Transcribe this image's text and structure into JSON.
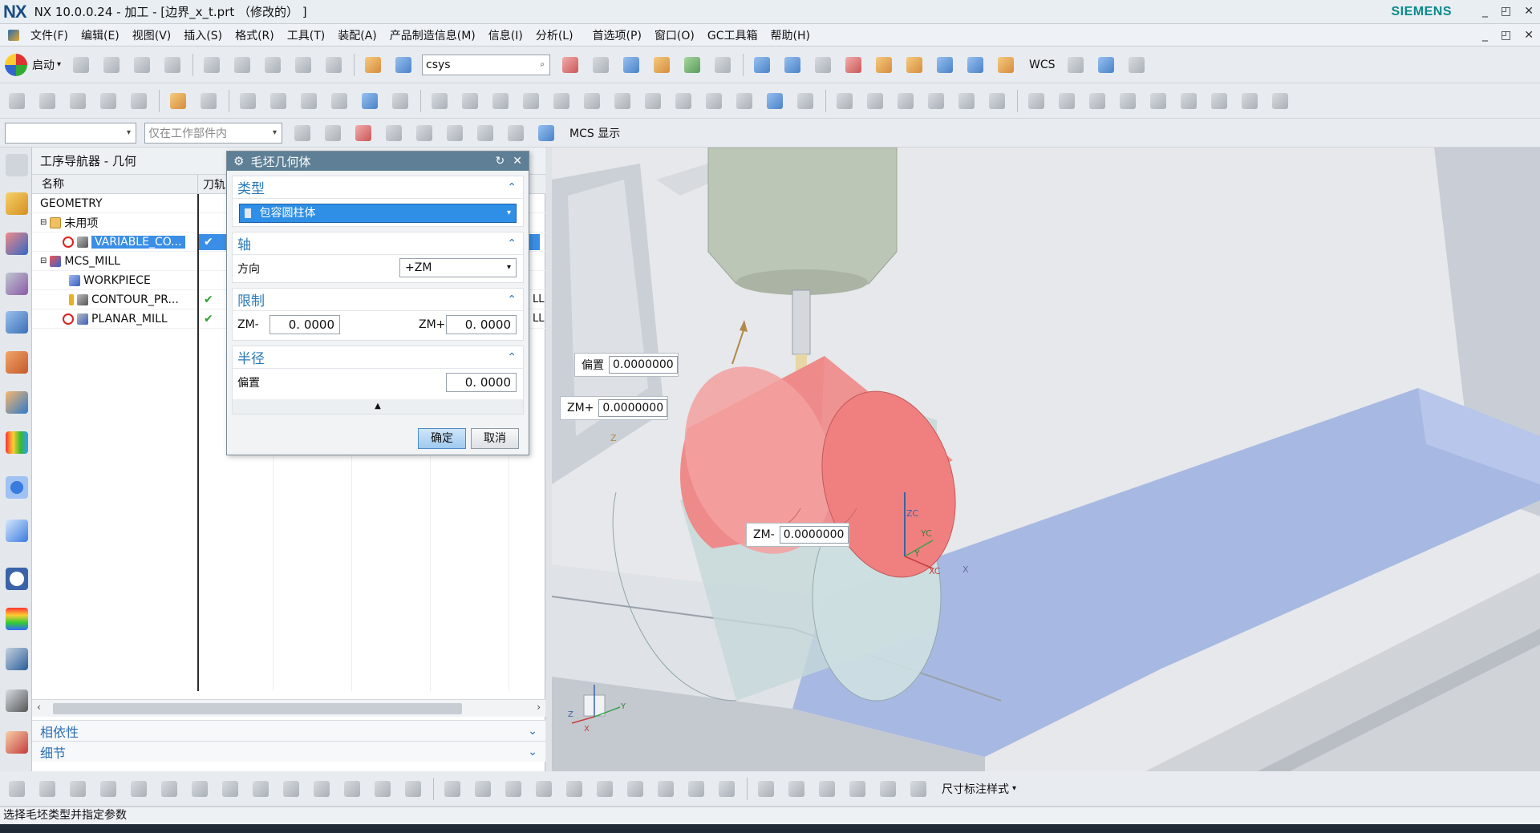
{
  "titlebar": {
    "logo": "NX",
    "title": "NX 10.0.0.24 - 加工 - [边界_x_t.prt （修改的） ]",
    "brand": "SIEMENS",
    "minimize": "_",
    "restore": "◰",
    "close": "✕"
  },
  "menubar": {
    "items": [
      "文件(F)",
      "编辑(E)",
      "视图(V)",
      "插入(S)",
      "格式(R)",
      "工具(T)",
      "装配(A)",
      "产品制造信息(M)",
      "信息(I)",
      "分析(L)",
      "首选项(P)",
      "窗口(O)",
      "GC工具箱",
      "帮助(H)"
    ]
  },
  "toolbar1": {
    "start_label": "启动",
    "csys_value": "csys",
    "wcs_label": "WCS"
  },
  "toolbar3": {
    "filter_placeholder": "",
    "scope_value": "仅在工作部件内",
    "mcs_label": "MCS 显示"
  },
  "navigator": {
    "title": "工序导航器 - 几何",
    "col_name": "名称",
    "col_tool": "刀轨",
    "rows": [
      {
        "label": "GEOMETRY",
        "indent": 0
      },
      {
        "label": "未用项",
        "indent": 1
      },
      {
        "label": "VARIABLE_CO...",
        "indent": 2,
        "check": "✔",
        "selected": true
      },
      {
        "label": "MCS_MILL",
        "indent": 1
      },
      {
        "label": "WORKPIECE",
        "indent": 2
      },
      {
        "label": "CONTOUR_PR...",
        "indent": 2,
        "check": "✔",
        "extra": "LL"
      },
      {
        "label": "PLANAR_MILL",
        "indent": 2,
        "check": "✔",
        "extra": "LL"
      }
    ],
    "dependencies": "相依性",
    "details": "细节"
  },
  "dialog": {
    "title": "毛坯几何体",
    "type_section": "类型",
    "type_value": "包容圆柱体",
    "axis_section": "轴",
    "direction_label": "方向",
    "direction_value": "+ZM",
    "limit_section": "限制",
    "zm_minus_label": "ZM-",
    "zm_minus_value": "0. 0000",
    "zm_plus_label": "ZM+",
    "zm_plus_value": "0. 0000",
    "radius_section": "半径",
    "offset_label": "偏置",
    "offset_value": "0. 0000",
    "ok": "确定",
    "cancel": "取消"
  },
  "viewport": {
    "offset_label": "偏置",
    "offset_value": "0.0000000",
    "zmplus_label": "ZM+",
    "zmplus_value": "0.0000000",
    "zmminus_label": "ZM-",
    "zmminus_value": "0.0000000",
    "axis_zc": "ZC",
    "axis_yc": "YC",
    "axis_xc": "XC",
    "axis_x": "X",
    "axis_y": "Y",
    "axis_z": "Z",
    "triad_x": "X",
    "triad_y": "Y",
    "triad_z": "Z"
  },
  "bottom_toolbar": {
    "dim_style_label": "尺寸标注样式"
  },
  "status": {
    "text": "选择毛坯类型并指定参数"
  },
  "colors": {
    "blank_cylinder": "#f08888",
    "selection_blue": "#3a8ee6",
    "dialog_title": "#5e7f95",
    "section_blue": "#2b7ab8"
  }
}
